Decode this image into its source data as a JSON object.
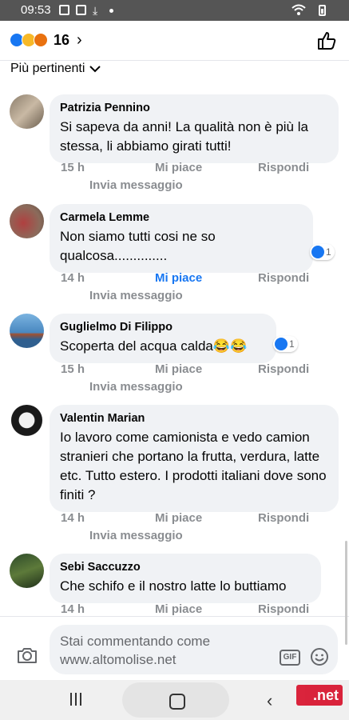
{
  "status_bar": {
    "time": "09:53"
  },
  "header": {
    "reaction_count": "16",
    "reactions": [
      "like",
      "sad",
      "angry"
    ]
  },
  "sort": {
    "label": "Più pertinenti"
  },
  "comments": [
    {
      "name": "Patrizia Pennino",
      "text": "Si sapeva da anni! La qualità non è più la stessa, li abbiamo girati tutti!",
      "time": "15 h",
      "like": "Mi piace",
      "reply": "Rispondi",
      "message": "Invia messaggio",
      "liked": false
    },
    {
      "name": "Carmela Lemme",
      "text": "Non siamo tutti cosi ne so qualcosa..............",
      "time": "14 h",
      "like": "Mi piace",
      "reply": "Rispondi",
      "message": "Invia messaggio",
      "liked": true,
      "reaction_count": "1"
    },
    {
      "name": "Guglielmo Di Filippo",
      "text": "Scoperta del acqua calda😂😂",
      "time": "15 h",
      "like": "Mi piace",
      "reply": "Rispondi",
      "message": "Invia messaggio",
      "liked": false,
      "reaction_count": "1"
    },
    {
      "name": "Valentin Marian",
      "text": "Io lavoro come camionista e vedo camion stranieri che portano la frutta, verdura, latte etc. Tutto estero.  I prodotti italiani dove sono finiti ?",
      "time": "14 h",
      "like": "Mi piace",
      "reply": "Rispondi",
      "message": "Invia messaggio",
      "liked": false
    },
    {
      "name": "Sebi Saccuzzo",
      "text": "Che schifo e il nostro latte lo buttiamo",
      "time": "14 h",
      "like": "Mi piace",
      "reply": "Rispondi",
      "liked": false
    }
  ],
  "composer": {
    "placeholder": "Stai commentando come www.altomolise.net",
    "gif_label": "GIF"
  },
  "watermark": ".net",
  "colors": {
    "accent": "#1877f2",
    "bubble": "#f0f2f5",
    "meta": "#8a8d91",
    "status_bar": "#555555"
  }
}
